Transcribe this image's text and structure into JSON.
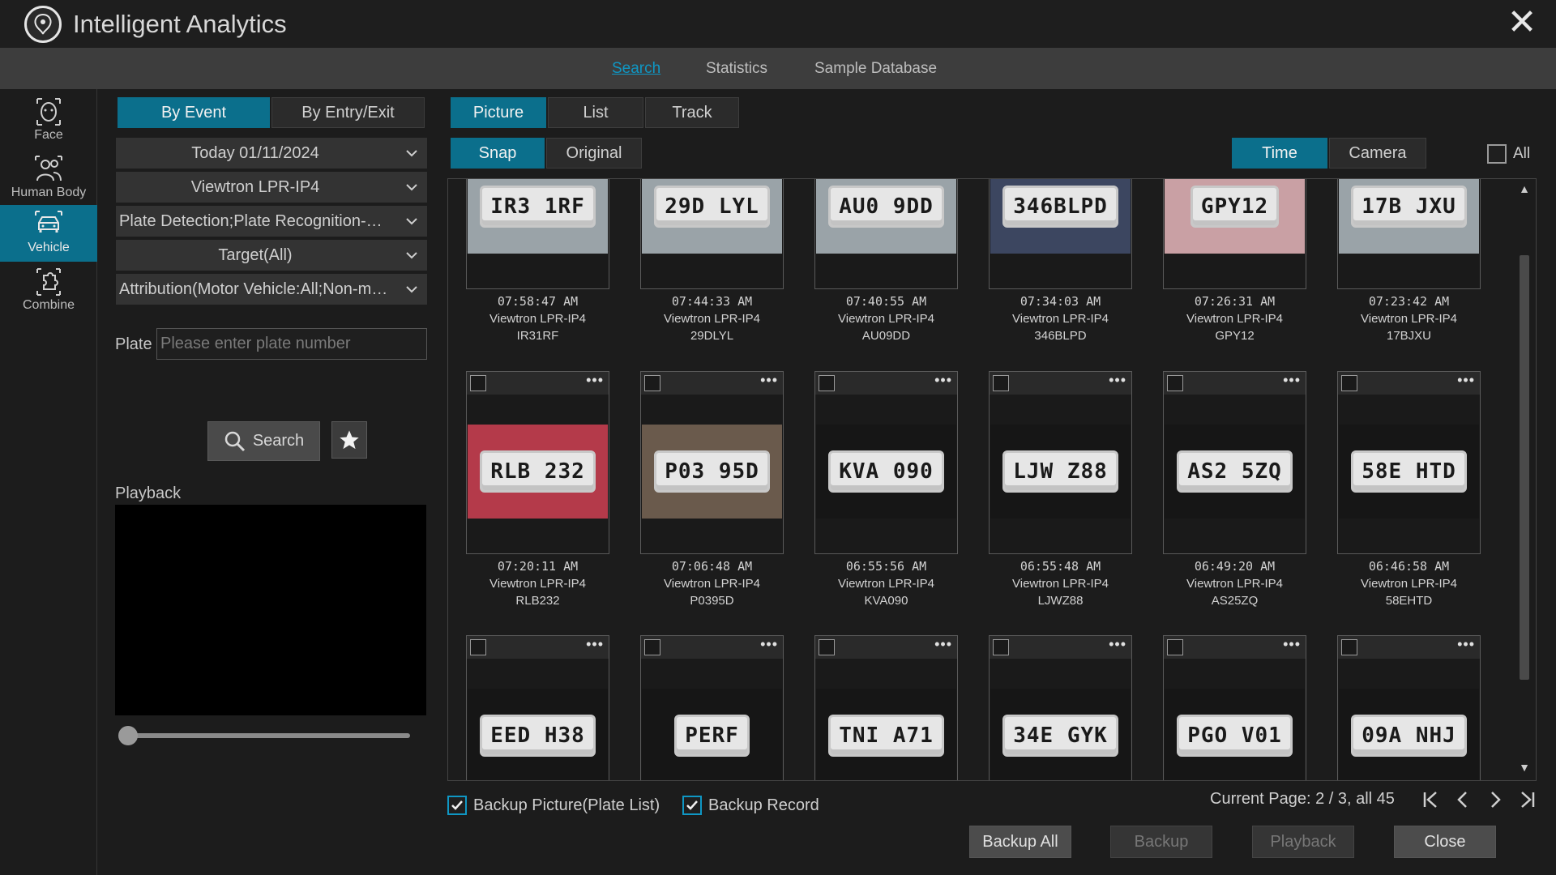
{
  "app": {
    "title": "Intelligent Analytics"
  },
  "topnav": {
    "tabs": [
      "Search",
      "Statistics",
      "Sample Database"
    ],
    "active": "Search"
  },
  "rail": {
    "items": [
      {
        "label": "Face",
        "icon": "face-icon"
      },
      {
        "label": "Human Body",
        "icon": "human-body-icon"
      },
      {
        "label": "Vehicle",
        "icon": "vehicle-icon"
      },
      {
        "label": "Combine",
        "icon": "combine-icon"
      }
    ],
    "active": "Vehicle"
  },
  "left": {
    "mode_tabs": [
      "By Event",
      "By Entry/Exit"
    ],
    "date": "Today 01/11/2024",
    "camera": "Viewtron LPR-IP4",
    "event_type": "Plate Detection;Plate Recognition-Su...",
    "target": "Target(All)",
    "attribution": "Attribution(Motor Vehicle:All;Non-mot...",
    "plate_label": "Plate",
    "plate_placeholder": "Please enter plate number",
    "plate_value": "",
    "search_label": "Search",
    "playback_label": "Playback",
    "playback_progress": 0
  },
  "view": {
    "type_tabs": [
      "Picture",
      "List",
      "Track"
    ],
    "image_tabs": [
      "Snap",
      "Original"
    ],
    "sort_tabs": [
      "Time",
      "Camera"
    ],
    "all_label": "All"
  },
  "results": [
    {
      "time": "07:58:47 AM",
      "camera": "Viewtron LPR-IP4",
      "plate": "IR31RF",
      "plate_shown": "IR3 1RF",
      "tone": "light"
    },
    {
      "time": "07:44:33 AM",
      "camera": "Viewtron LPR-IP4",
      "plate": "29DLYL",
      "plate_shown": "29D LYL",
      "tone": "light"
    },
    {
      "time": "07:40:55 AM",
      "camera": "Viewtron LPR-IP4",
      "plate": "AU09DD",
      "plate_shown": "AU0 9DD",
      "tone": "light"
    },
    {
      "time": "07:34:03 AM",
      "camera": "Viewtron LPR-IP4",
      "plate": "346BLPD",
      "plate_shown": "346BLPD",
      "tone": "dark"
    },
    {
      "time": "07:26:31 AM",
      "camera": "Viewtron LPR-IP4",
      "plate": "GPY12",
      "plate_shown": "GPY12",
      "tone": "pink"
    },
    {
      "time": "07:23:42 AM",
      "camera": "Viewtron LPR-IP4",
      "plate": "17BJXU",
      "plate_shown": "17B JXU",
      "tone": "light"
    },
    {
      "time": "07:20:11 AM",
      "camera": "Viewtron LPR-IP4",
      "plate": "RLB232",
      "plate_shown": "RLB 232",
      "tone": "red"
    },
    {
      "time": "07:06:48 AM",
      "camera": "Viewtron LPR-IP4",
      "plate": "P0395D",
      "plate_shown": "P03 95D",
      "tone": "brown"
    },
    {
      "time": "06:55:56 AM",
      "camera": "Viewtron LPR-IP4",
      "plate": "KVA090",
      "plate_shown": "KVA 090",
      "tone": "night"
    },
    {
      "time": "06:55:48 AM",
      "camera": "Viewtron LPR-IP4",
      "plate": "LJWZ88",
      "plate_shown": "LJW Z88",
      "tone": "night"
    },
    {
      "time": "06:49:20 AM",
      "camera": "Viewtron LPR-IP4",
      "plate": "AS25ZQ",
      "plate_shown": "AS2 5ZQ",
      "tone": "night"
    },
    {
      "time": "06:46:58 AM",
      "camera": "Viewtron LPR-IP4",
      "plate": "58EHTD",
      "plate_shown": "58E HTD",
      "tone": "night"
    },
    {
      "time": "",
      "camera": "",
      "plate": "",
      "plate_shown": "EED H38",
      "tone": "night"
    },
    {
      "time": "",
      "camera": "",
      "plate": "",
      "plate_shown": "PERF",
      "tone": "night"
    },
    {
      "time": "",
      "camera": "",
      "plate": "",
      "plate_shown": "TNI A71",
      "tone": "night"
    },
    {
      "time": "",
      "camera": "",
      "plate": "",
      "plate_shown": "34E GYK",
      "tone": "night"
    },
    {
      "time": "",
      "camera": "",
      "plate": "",
      "plate_shown": "PGO V01",
      "tone": "night"
    },
    {
      "time": "",
      "camera": "",
      "plate": "",
      "plate_shown": "09A NHJ",
      "tone": "night"
    }
  ],
  "bottom": {
    "backup_picture_label": "Backup Picture(Plate List)",
    "backup_picture_checked": true,
    "backup_record_label": "Backup Record",
    "backup_record_checked": true,
    "page_info": "Current Page: 2 / 3, all 45",
    "buttons": [
      "Backup All",
      "Backup",
      "Playback",
      "Close"
    ]
  },
  "colors": {
    "accent": "#0b6f8c",
    "link": "#0f97c4"
  }
}
